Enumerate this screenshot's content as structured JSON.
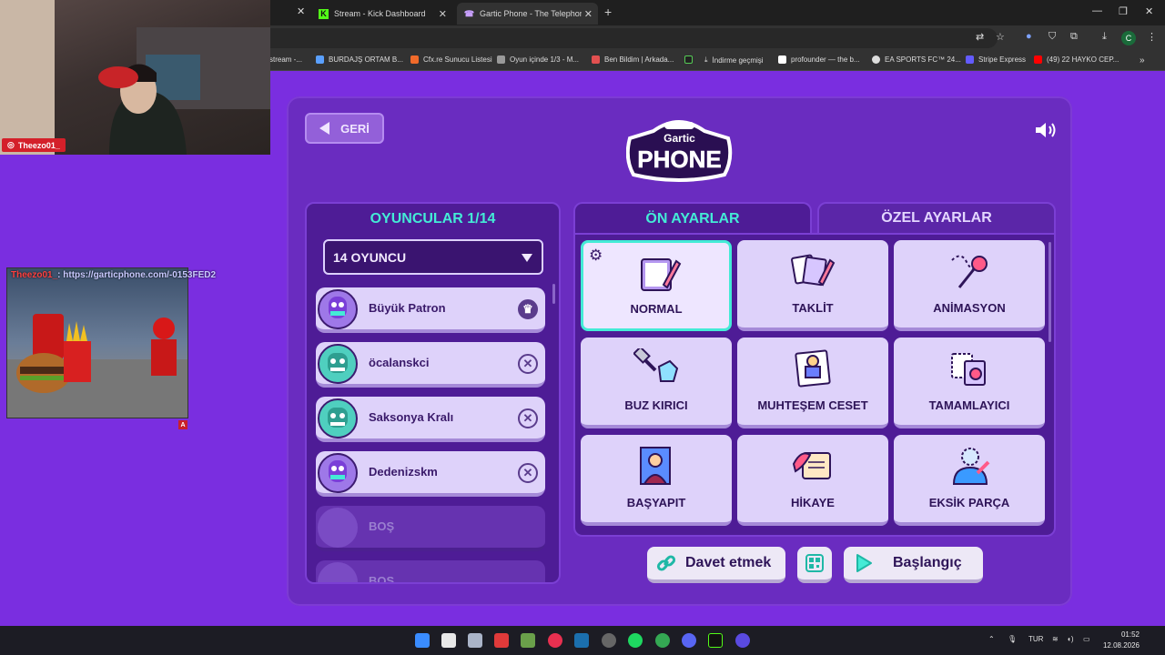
{
  "browser": {
    "tabs": [
      {
        "label": "Stream - Kick Dashboard"
      },
      {
        "label": "Gartic Phone - The Telephone G"
      }
    ],
    "bookmarks": [
      "stream -...",
      "BURDAJŞ ORTAM B...",
      "Cfx.re Sunucu Listesi",
      "Oyun içinde 1/3 - M...",
      "Ben Bildim | Arkada...",
      "İndirme geçmişi",
      "profounder — the b...",
      "EA SPORTS FC™ 24...",
      "Stripe Express",
      "(49) 22 HAYKO CEP..."
    ],
    "profile_letter": "C"
  },
  "game": {
    "back_label": "GERİ",
    "logo_top": "Gartic",
    "logo_bottom": "PHONE",
    "players_title": "OYUNCULAR 1/14",
    "player_count_select": "14 OYUNCU",
    "players": [
      {
        "name": "Büyük Patron",
        "action": "♛"
      },
      {
        "name": "öcalanskci",
        "action": "✕"
      },
      {
        "name": "Saksonya Kralı",
        "action": "✕"
      },
      {
        "name": "Dedenizskm",
        "action": "✕"
      },
      {
        "name": "BOŞ",
        "action": ""
      },
      {
        "name": "BOŞ",
        "action": ""
      }
    ],
    "tabs": {
      "presets": "ÖN AYARLAR",
      "custom": "ÖZEL AYARLAR"
    },
    "modes": [
      "NORMAL",
      "TAKLİT",
      "ANİMASYON",
      "BUZ KIRICI",
      "MUHTEŞEM CESET",
      "TAMAMLAYICI",
      "BAŞYAPIT",
      "HİKAYE",
      "EKSİK PARÇA"
    ],
    "invite_label": "Davet etmek",
    "start_label": "Başlangıç"
  },
  "overlay": {
    "cam_handle": "Theezo01_",
    "ad_user": "Theezo01_",
    "ad_link": ": https://garticphone.com/-0153FED2",
    "ad_tag": "A"
  },
  "taskbar": {
    "lang": "TUR",
    "time": "01:52",
    "date": "12.08.2026"
  },
  "colors": {
    "accent": "#44ebd6",
    "panel": "#4e1c96",
    "background": "#7a2ee0"
  }
}
